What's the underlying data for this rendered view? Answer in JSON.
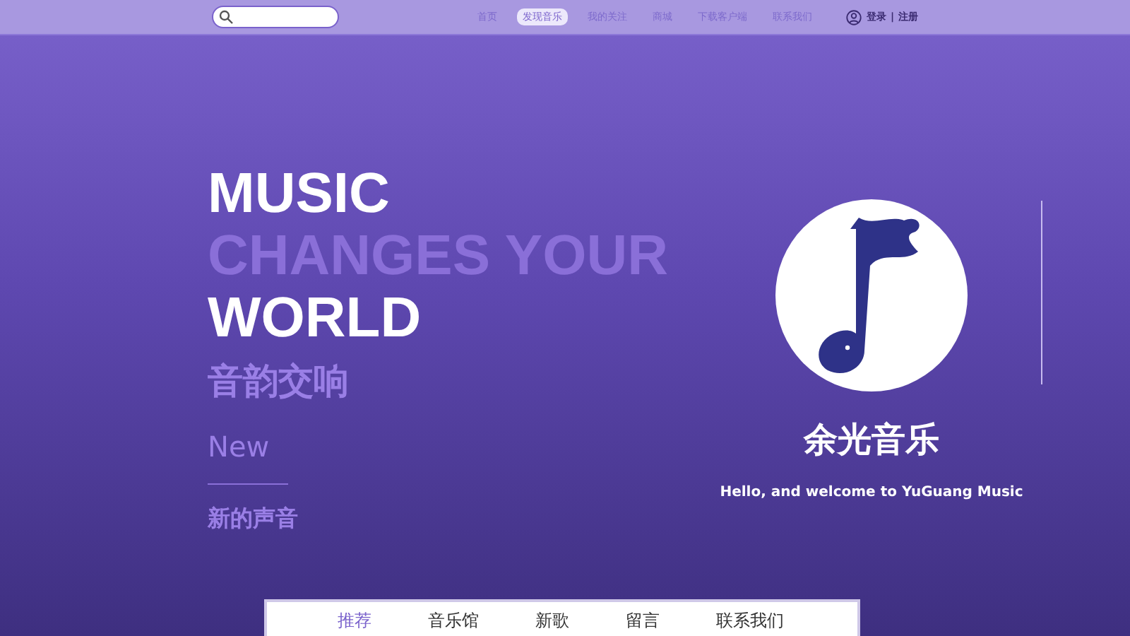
{
  "nav": [
    {
      "label": "首页",
      "selected": false
    },
    {
      "label": "发现音乐",
      "selected": true
    },
    {
      "label": "我的关注",
      "selected": false
    },
    {
      "label": "商城",
      "selected": false
    },
    {
      "label": "下载客户端",
      "selected": false
    },
    {
      "label": "联系我们",
      "selected": false
    }
  ],
  "account": {
    "login": "登录",
    "separator": "|",
    "register": "注册"
  },
  "hero": {
    "lines": [
      {
        "text": "MUSIC",
        "kind": "bright"
      },
      {
        "text": "CHANGES YOUR",
        "kind": "dim"
      },
      {
        "text": "WORLD",
        "kind": "bright"
      }
    ],
    "subtitle": "音韵交响",
    "tag": "New",
    "tagline": "新的声音"
  },
  "brand": {
    "name": "余光音乐",
    "welcome": "Hello, and welcome to YuGuang Music"
  },
  "tabs": [
    {
      "label": "推荐",
      "selected": true
    },
    {
      "label": "音乐馆",
      "selected": false
    },
    {
      "label": "新歌",
      "selected": false
    },
    {
      "label": "留言",
      "selected": false
    },
    {
      "label": "联系我们",
      "selected": false
    }
  ]
}
